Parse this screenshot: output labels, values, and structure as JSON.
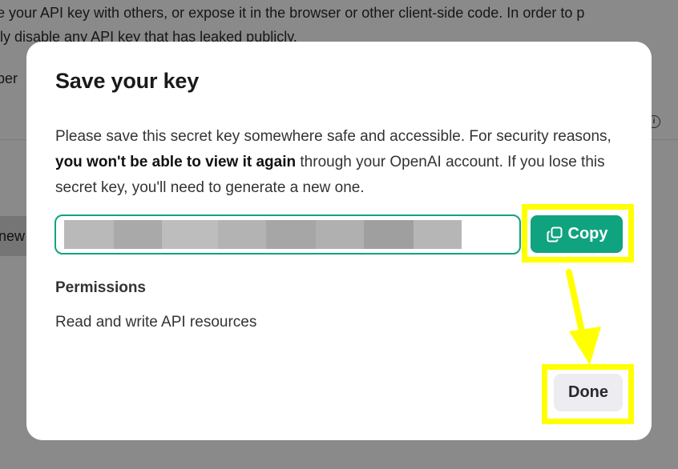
{
  "background": {
    "line1": "e your API key with others, or expose it in the browser or other client-side code. In order to p",
    "line2": "lly disable any API key that has leaked publicly.",
    "permissions_partial": "per",
    "new_button_partial": "new"
  },
  "modal": {
    "title": "Save your key",
    "description": {
      "part1": "Please save this secret key somewhere safe and accessible. For security reasons, ",
      "bold": "you won't be able to view it again",
      "part2": " through your OpenAI account. If you lose this secret key, you'll need to generate a new one."
    },
    "key_field": {
      "value": "",
      "redacted": true,
      "blur_shades": [
        "#b9b9b9",
        "#a9a9a9",
        "#bdbdbd",
        "#b3b3b3",
        "#a6a6a6",
        "#b0b0b0",
        "#9f9f9f",
        "#b6b6b6"
      ]
    },
    "copy_button": {
      "label": "Copy",
      "icon": "copy-icon"
    },
    "permissions": {
      "label": "Permissions",
      "value": "Read and write API resources"
    },
    "done_button": {
      "label": "Done"
    }
  },
  "annotations": {
    "highlight_color": "#ffff00",
    "highlighted": [
      "copy-button",
      "done-button"
    ],
    "arrow": "from copy-button to done-button"
  },
  "colors": {
    "accent": "#10a37f",
    "overlay": "rgba(0,0,0,0.46)",
    "done_bg": "#ececf1"
  }
}
